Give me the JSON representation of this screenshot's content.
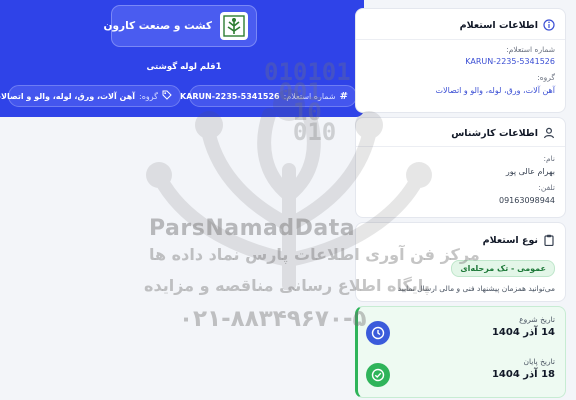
{
  "header": {
    "company_name": "کشت و صنعت کارون",
    "subject": "1قلم لوله گوشتی",
    "ref_chip": {
      "label": "شماره استعلام:",
      "value": "KARUN-2235-5341526",
      "icon": "hash-icon"
    },
    "group_chip": {
      "label": "گروه:",
      "value": "آهن آلات، ورق، لوله، والو و اتصالات",
      "icon": "tag-icon"
    }
  },
  "info_card": {
    "title": "اطلاعات استعلام",
    "icon": "info-icon",
    "ref_label": "شماره استعلام:",
    "ref_value": "KARUN-2235-5341526",
    "group_label": "گروه:",
    "group_value": "آهن آلات، ورق، لوله، والو و اتصالات"
  },
  "expert_card": {
    "title": "اطلاعات کارشناس",
    "icon": "user-icon",
    "name_label": "نام:",
    "name_value": "بهرام عالی پور",
    "phone_label": "تلفن:",
    "phone_value": "09163098944"
  },
  "type_card": {
    "title": "نوع استعلام",
    "icon": "clipboard-icon",
    "badge": "عمومی - تک مرحله‌ای",
    "description": "می‌توانید همزمان پیشنهاد فنی و مالی ارسال نمایید"
  },
  "dates_card": {
    "start_label": "تاریخ شروع",
    "start_value": "14 آذر 1404",
    "end_label": "تاریخ پایان",
    "end_value": "18 آذر 1404"
  },
  "watermark": {
    "digits": "010101\n 001\n  10\n  010",
    "brand": "ParsNamadData",
    "line1": "مرکز فن آوری اطلاعات پارس نماد داده ها",
    "line2": "پایگاه اطلاع رسانی مناقصه و مزایده",
    "phone": "۰۲۱-۸۸۳۴۹۶۷۰-۵"
  },
  "colors": {
    "header_bg": "#2f43e8",
    "accent_green": "#2fb45a",
    "accent_blue": "#3b5bdb"
  }
}
